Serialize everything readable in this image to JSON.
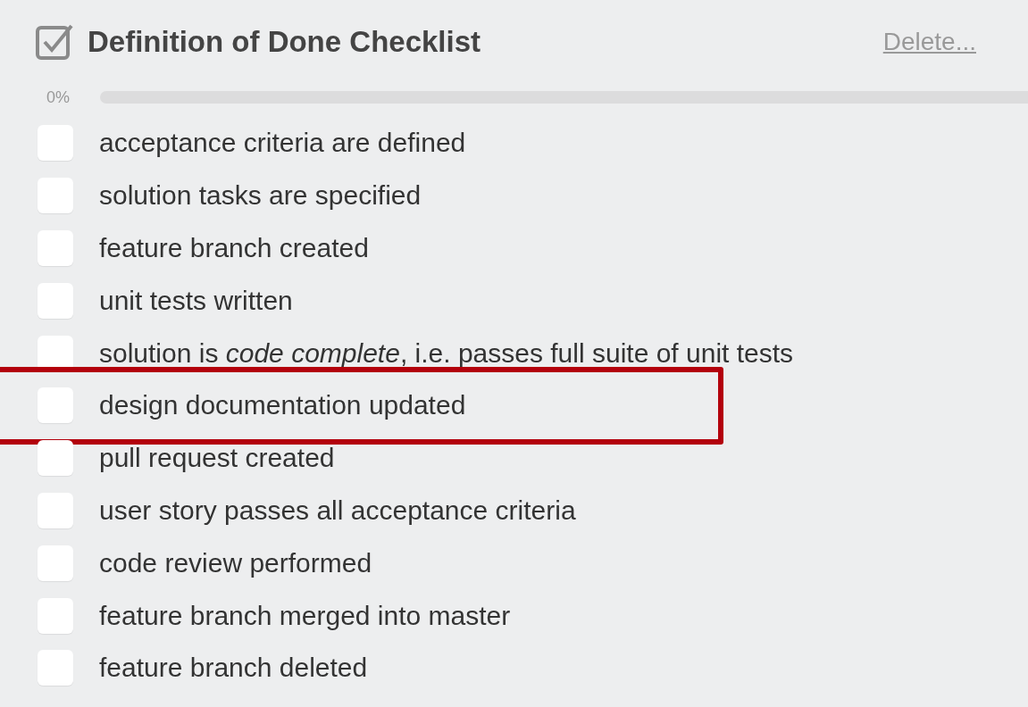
{
  "checklist": {
    "title": "Definition of Done Checklist",
    "delete_link": "Delete...",
    "progress_text": "0%",
    "level": 0,
    "items": [
      {
        "label": "acceptance criteria are defined",
        "checked": false,
        "highlighted": false
      },
      {
        "label": "solution tasks are specified",
        "checked": false,
        "highlighted": false
      },
      {
        "label": "feature branch created",
        "checked": false,
        "highlighted": false
      },
      {
        "label": "unit tests written",
        "checked": false,
        "highlighted": false
      },
      {
        "label": "solution is *code complete*, i.e. passes full suite of unit tests",
        "checked": false,
        "highlighted": false
      },
      {
        "label": "design documentation updated",
        "checked": false,
        "highlighted": true
      },
      {
        "label": "pull request created",
        "checked": false,
        "highlighted": false
      },
      {
        "label": "user story passes all acceptance criteria",
        "checked": false,
        "highlighted": false
      },
      {
        "label": "code review performed",
        "checked": false,
        "highlighted": false
      },
      {
        "label": "feature branch merged into master",
        "checked": false,
        "highlighted": false
      },
      {
        "label": "feature branch deleted",
        "checked": false,
        "highlighted": false
      }
    ]
  }
}
